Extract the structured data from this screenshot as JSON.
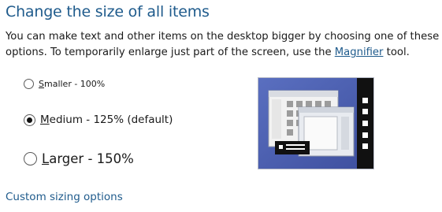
{
  "title": "Change the size of all items",
  "description": {
    "before_link": "You can make text and other items on the desktop bigger by choosing one of these options. To temporarily enlarge just part of the screen, use the ",
    "link": "Magnifier",
    "after_link": " tool."
  },
  "options": [
    {
      "accel": "S",
      "rest": "maller - 100%",
      "checked": false
    },
    {
      "accel": "M",
      "rest": "edium - 125% (default)",
      "checked": true
    },
    {
      "accel": "L",
      "rest": "arger - 150%",
      "checked": false
    }
  ],
  "custom_link": "Custom sizing options",
  "colors": {
    "accent": "#1f5b8c",
    "preview_bg": "#4f64b4",
    "taskbar": "#111111"
  },
  "icons": {
    "preview": "desktop-preview-icon"
  }
}
